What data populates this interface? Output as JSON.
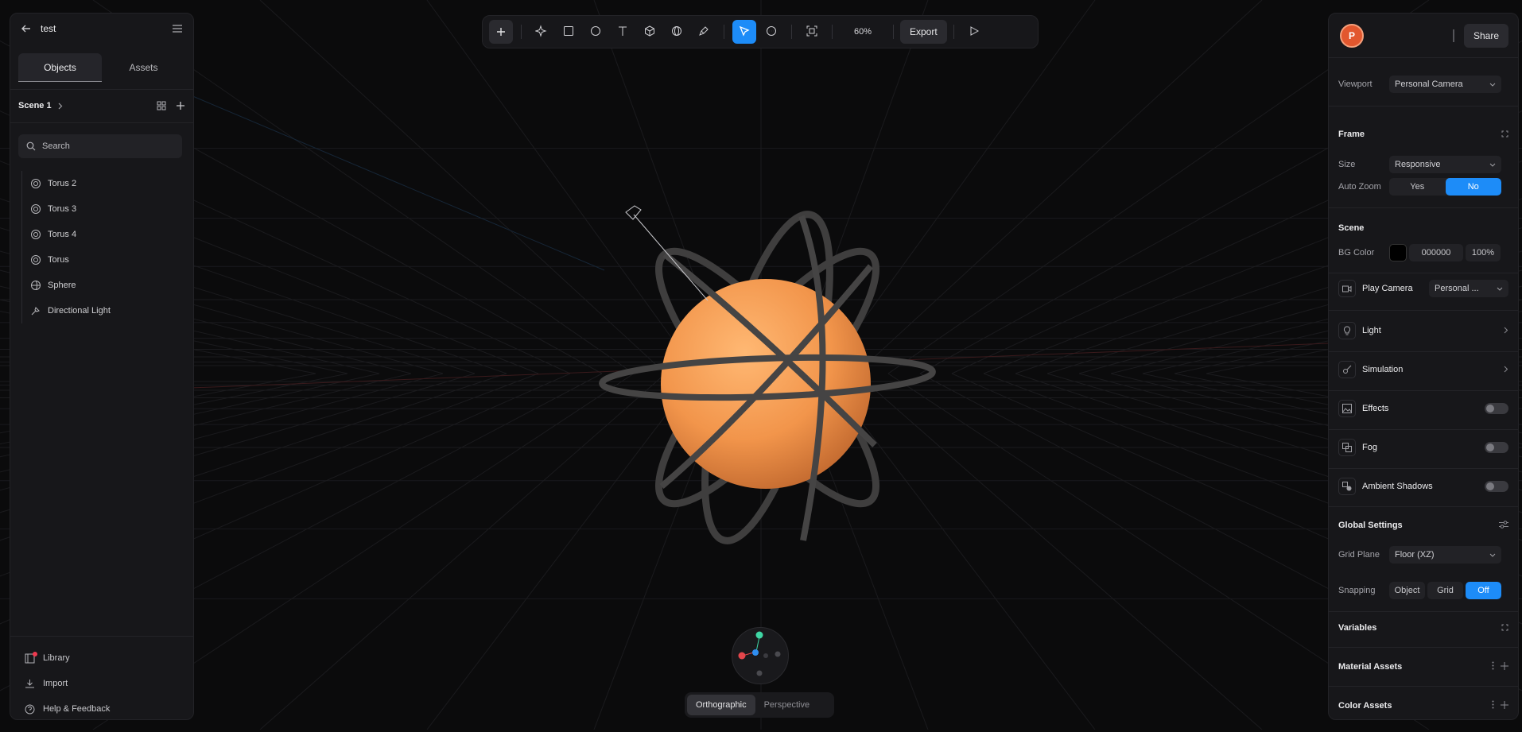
{
  "project": {
    "title": "test"
  },
  "left_panel": {
    "tabs": [
      {
        "label": "Objects"
      },
      {
        "label": "Assets"
      }
    ],
    "scene": {
      "label": "Scene 1"
    },
    "search": {
      "placeholder": "Search"
    },
    "tree": [
      {
        "label": "Torus 2",
        "icon": "torus-icon"
      },
      {
        "label": "Torus 3",
        "icon": "torus-icon"
      },
      {
        "label": "Torus 4",
        "icon": "torus-icon"
      },
      {
        "label": "Torus",
        "icon": "torus-icon"
      },
      {
        "label": "Sphere",
        "icon": "sphere-icon"
      },
      {
        "label": "Directional Light",
        "icon": "directional-light-icon"
      }
    ],
    "bottom": [
      {
        "label": "Library",
        "icon": "library-icon"
      },
      {
        "label": "Import",
        "icon": "import-icon"
      },
      {
        "label": "Help & Feedback",
        "icon": "help-icon"
      }
    ]
  },
  "toolbar": {
    "zoom": "60%",
    "export_label": "Export"
  },
  "projection": {
    "options": [
      {
        "label": "Orthographic"
      },
      {
        "label": "Perspective"
      }
    ],
    "selected": "Orthographic"
  },
  "right_panel": {
    "avatar_initial": "P",
    "share_label": "Share",
    "viewport": {
      "label": "Viewport",
      "value": "Personal Camera"
    },
    "frame": {
      "title": "Frame",
      "size_label": "Size",
      "size_value": "Responsive",
      "autozoom_label": "Auto Zoom",
      "autozoom_yes": "Yes",
      "autozoom_no": "No",
      "autozoom_selected": "No"
    },
    "scene": {
      "title": "Scene",
      "bg_label": "BG Color",
      "bg_hex": "000000",
      "bg_opacity": "100%",
      "bg_swatch": "#000000"
    },
    "play_camera": {
      "label": "Play Camera",
      "value": "Personal ..."
    },
    "light": {
      "label": "Light"
    },
    "simulation": {
      "label": "Simulation"
    },
    "effects": {
      "label": "Effects",
      "enabled": false
    },
    "fog": {
      "label": "Fog",
      "enabled": false
    },
    "ambient_shadows": {
      "label": "Ambient Shadows",
      "enabled": false
    },
    "global_settings": {
      "title": "Global Settings",
      "grid_plane_label": "Grid Plane",
      "grid_plane_value": "Floor (XZ)",
      "snapping_label": "Snapping",
      "snapping_options": [
        "Object",
        "Grid",
        "Off"
      ],
      "snapping_selected": "Off"
    },
    "variables": {
      "title": "Variables"
    },
    "material_assets": {
      "title": "Material Assets"
    },
    "color_assets": {
      "title": "Color Assets"
    }
  },
  "colors": {
    "accent": "#1d8cf8",
    "sphere": "#f2954b",
    "torus": "#3f3e3e"
  }
}
